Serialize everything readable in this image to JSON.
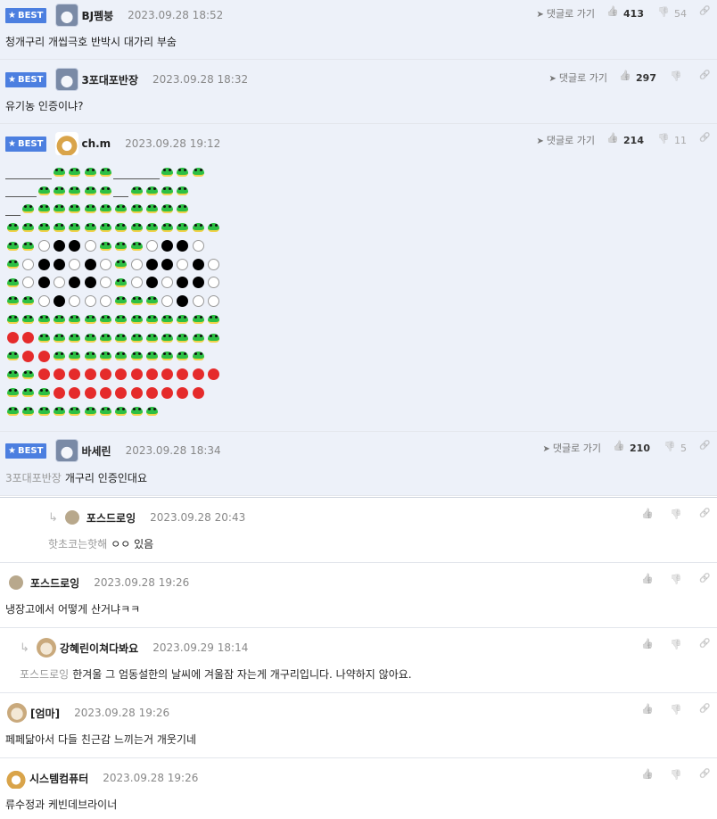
{
  "best_label": "BEST",
  "goto_label": "댓글로 가기",
  "comments": [
    {
      "nick": "BJ펨붕",
      "date": "2023.09.28 18:52",
      "text": "청개구리 개씹극호 반박시 대가리 부숨",
      "up": "413",
      "down": "54",
      "avatar": "wolf-avatar"
    },
    {
      "nick": "3포대포반장",
      "date": "2023.09.28 18:32",
      "text": "유기농 인증이냐?",
      "up": "297",
      "down": "",
      "avatar": "wolf-avatar"
    },
    {
      "nick": "ch.m",
      "date": "2023.09.28 19:12",
      "text": "",
      "up": "214",
      "down": "11",
      "avatar": "fox-avatar"
    },
    {
      "nick": "바세린",
      "date": "2023.09.28 18:34",
      "mention": "3포대포반장",
      "text": "개구리 인증인대요",
      "up": "210",
      "down": "5",
      "avatar": "wolf-avatar"
    },
    {
      "nick": "포스드로잉",
      "date": "2023.09.28 20:43",
      "mention": "핫초코는핫해",
      "text": "ㅇㅇ 있음",
      "avatar": "dot-avatar"
    },
    {
      "nick": "포스드로잉",
      "date": "2023.09.28 19:26",
      "text": "냉장고에서 어떻게 산거냐ㅋㅋ",
      "avatar": "dot-avatar"
    },
    {
      "nick": "강혜린이쳐다봐요",
      "date": "2023.09.29 18:14",
      "mention": "포스드로잉",
      "text": "한겨울 그 엄동설한의 날씨에 겨울잠 자는게 개구리입니다. 나약하지 않아요.",
      "avatar": "puppy-avatar"
    },
    {
      "nick": "[엄마]",
      "date": "2023.09.28 19:26",
      "text": "페페닮아서 다들 친근감 느끼는거 개웃기네",
      "avatar": "puppy-avatar"
    },
    {
      "nick": "시스템컴퓨터",
      "date": "2023.09.28 19:26",
      "text": "류수정과 케빈데브라이너",
      "avatar": "fox-avatar"
    }
  ],
  "emoji_art": [
    "___FFFF___FFF",
    "__FFFFF_FFFF",
    "_FFFFFFFFFFF",
    "FFFFFFFFFFFFFF",
    "FFWBBWFFFWBBW",
    "FWBBWBWFWBBWBW",
    "FWBWBBWFWBWBBW",
    "FFWBWWWFFFWBWW",
    "FFFFFFFFFFFFFF",
    "RRFFFFFFFFFFFF",
    "FRRFFFFFFFFFF",
    "FFRRRRRRRRRRRR",
    "FFFRRRRRRRRRR",
    "FFFFFFFFFF"
  ],
  "colors": {
    "best_bg": "#edf1f9",
    "badge": "#4c7fe0",
    "frog": "#2cbf44",
    "red_dot": "#e52b2b"
  }
}
